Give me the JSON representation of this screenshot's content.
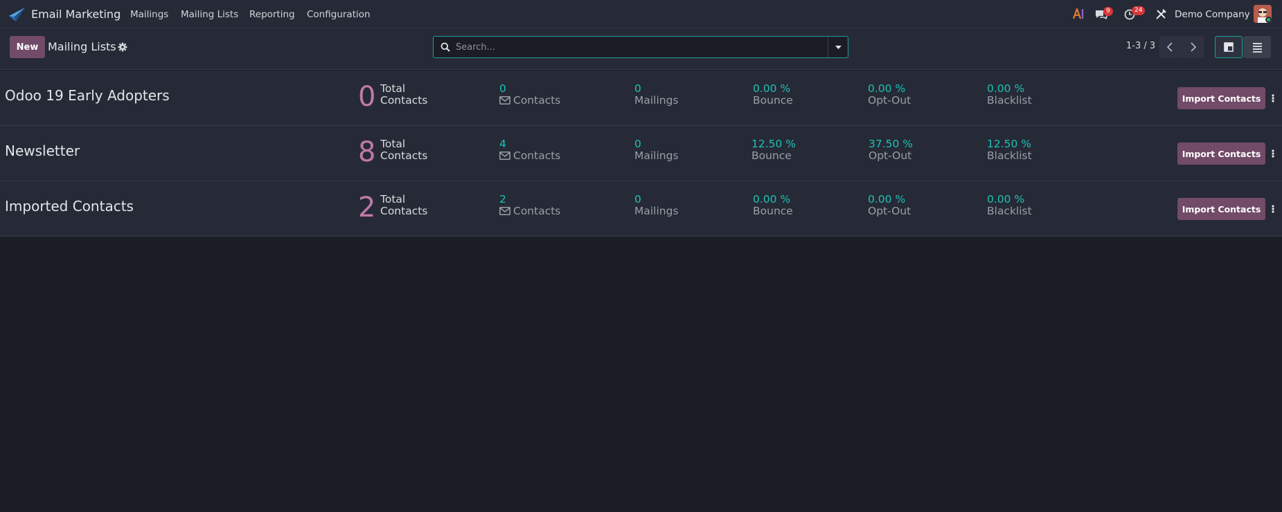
{
  "app": {
    "name": "Email Marketing"
  },
  "menu": [
    "Mailings",
    "Mailing Lists",
    "Reporting",
    "Configuration"
  ],
  "systray": {
    "messages_count": "9",
    "activities_count": "24",
    "company": "Demo Company"
  },
  "control": {
    "new_label": "New",
    "breadcrumb": "Mailing Lists",
    "search_placeholder": "Search...",
    "pager": "1-3 / 3"
  },
  "rows": [
    {
      "name": "Odoo 19 Early Adopters",
      "total": "0",
      "total_label_1": "Total",
      "total_label_2": "Contacts",
      "contacts": "0",
      "contacts_label": "Contacts",
      "mailings": "0",
      "mailings_label": "Mailings",
      "bounce": "0.00 %",
      "bounce_label": "Bounce",
      "optout": "0.00 %",
      "optout_label": "Opt-Out",
      "blacklist": "0.00 %",
      "blacklist_label": "Blacklist",
      "action": "Import Contacts"
    },
    {
      "name": "Newsletter",
      "total": "8",
      "total_label_1": "Total",
      "total_label_2": "Contacts",
      "contacts": "4",
      "contacts_label": "Contacts",
      "mailings": "0",
      "mailings_label": "Mailings",
      "bounce": "12.50 %",
      "bounce_label": "Bounce",
      "optout": "37.50 %",
      "optout_label": "Opt-Out",
      "blacklist": "12.50 %",
      "blacklist_label": "Blacklist",
      "action": "Import Contacts"
    },
    {
      "name": "Imported Contacts",
      "total": "2",
      "total_label_1": "Total",
      "total_label_2": "Contacts",
      "contacts": "2",
      "contacts_label": "Contacts",
      "mailings": "0",
      "mailings_label": "Mailings",
      "bounce": "0.00 %",
      "bounce_label": "Bounce",
      "optout": "0.00 %",
      "optout_label": "Opt-Out",
      "blacklist": "0.00 %",
      "blacklist_label": "Blacklist",
      "action": "Import Contacts"
    }
  ],
  "colors": {
    "brand": "#714b67",
    "accent": "#1ec1b6",
    "count": "#c07aa9"
  }
}
